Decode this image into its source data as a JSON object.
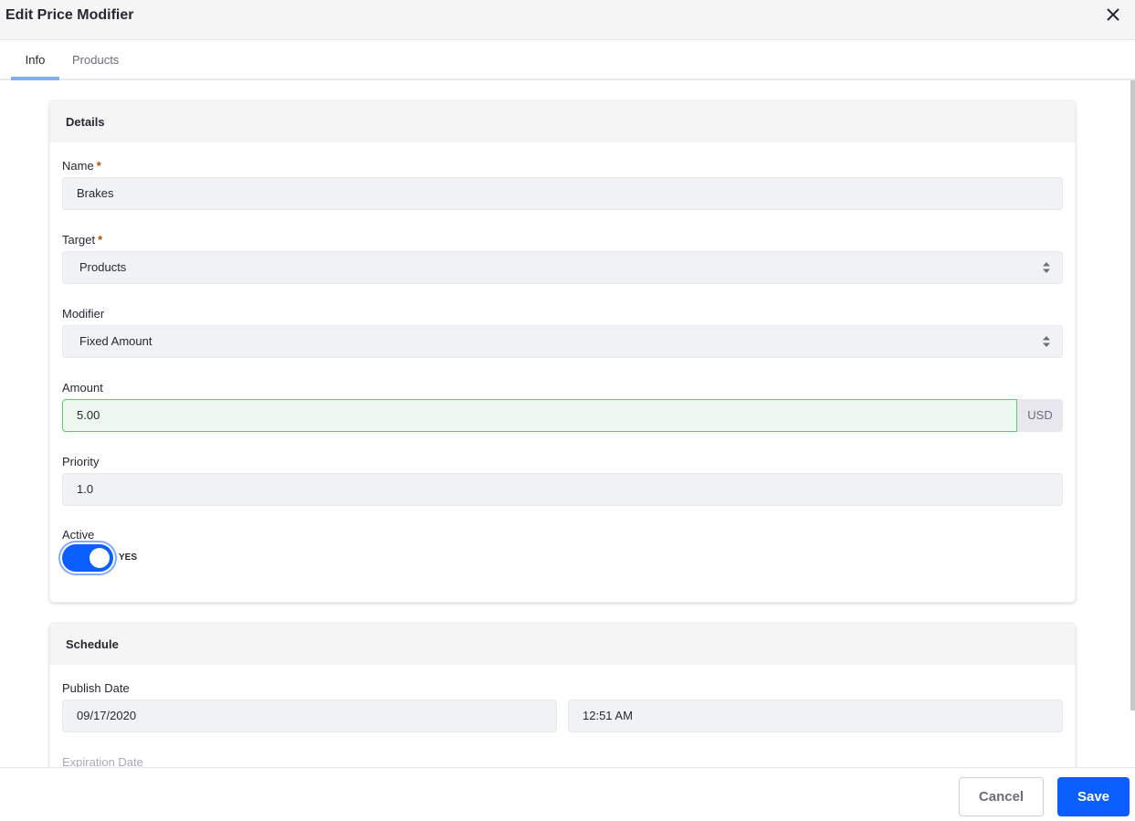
{
  "modal": {
    "title": "Edit Price Modifier",
    "close_icon": "close-icon"
  },
  "tabs": [
    {
      "label": "Info",
      "active": true
    },
    {
      "label": "Products",
      "active": false
    }
  ],
  "details": {
    "header": "Details",
    "name": {
      "label": "Name",
      "required_marker": "*",
      "value": "Brakes"
    },
    "target": {
      "label": "Target",
      "required_marker": "*",
      "value": "Products"
    },
    "modifier": {
      "label": "Modifier",
      "value": "Fixed Amount"
    },
    "amount": {
      "label": "Amount",
      "value": "5.00",
      "currency": "USD"
    },
    "priority": {
      "label": "Priority",
      "value": "1.0"
    },
    "active": {
      "label": "Active",
      "state": true,
      "state_text": "YES"
    }
  },
  "schedule": {
    "header": "Schedule",
    "publish_date": {
      "label": "Publish Date",
      "date": "09/17/2020",
      "time": "12:51 AM"
    },
    "expiration_date": {
      "label": "Expiration Date"
    }
  },
  "footer": {
    "cancel_label": "Cancel",
    "save_label": "Save"
  },
  "colors": {
    "primary": "#0b5fff",
    "tab_indicator": "#80acff",
    "valid_border": "#5aca75",
    "required": "#b95000"
  }
}
